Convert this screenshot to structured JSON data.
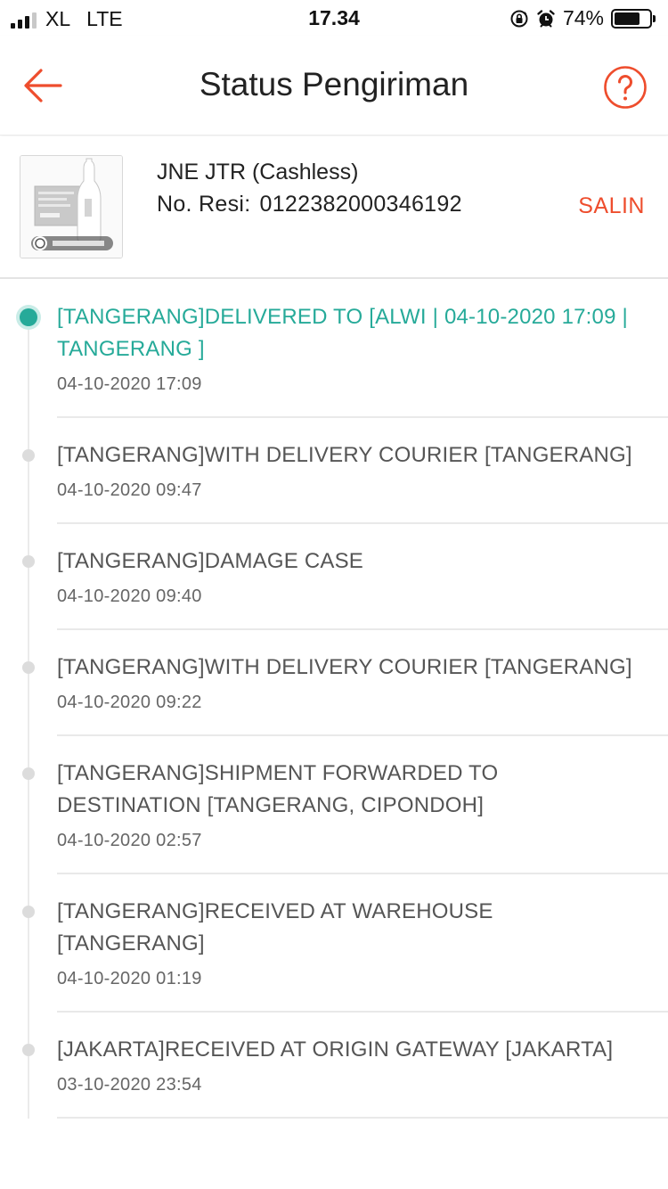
{
  "status_bar": {
    "carrier": "XL",
    "network": "LTE",
    "time": "17.34",
    "battery": "74%",
    "battery_level": 0.74
  },
  "header": {
    "title": "Status Pengiriman",
    "back_icon": "arrow-left-icon",
    "help_icon": "question-circle-icon"
  },
  "shipment": {
    "courier": "JNE JTR (Cashless)",
    "resi_label": "No. Resi:",
    "resi_number": "0122382000346192",
    "copy_label": "SALIN"
  },
  "colors": {
    "accent": "#ee4d2d",
    "active": "#26aa99",
    "inactive_dot": "#dcdcdc"
  },
  "events": [
    {
      "description": "[TANGERANG]DELIVERED TO [ALWI | 04-10-2020 17:09 | TANGERANG ]",
      "time": "04-10-2020 17:09"
    },
    {
      "description": "[TANGERANG]WITH DELIVERY COURIER [TANGERANG]",
      "time": "04-10-2020 09:47"
    },
    {
      "description": "[TANGERANG]DAMAGE CASE",
      "time": "04-10-2020 09:40"
    },
    {
      "description": "[TANGERANG]WITH DELIVERY COURIER [TANGERANG]",
      "time": "04-10-2020 09:22"
    },
    {
      "description": "[TANGERANG]SHIPMENT FORWARDED TO DESTINATION [TANGERANG, CIPONDOH]",
      "time": "04-10-2020 02:57"
    },
    {
      "description": "[TANGERANG]RECEIVED AT WAREHOUSE [TANGERANG]",
      "time": "04-10-2020 01:19"
    },
    {
      "description": "[JAKARTA]RECEIVED AT ORIGIN GATEWAY [JAKARTA]",
      "time": "03-10-2020 23:54"
    }
  ]
}
